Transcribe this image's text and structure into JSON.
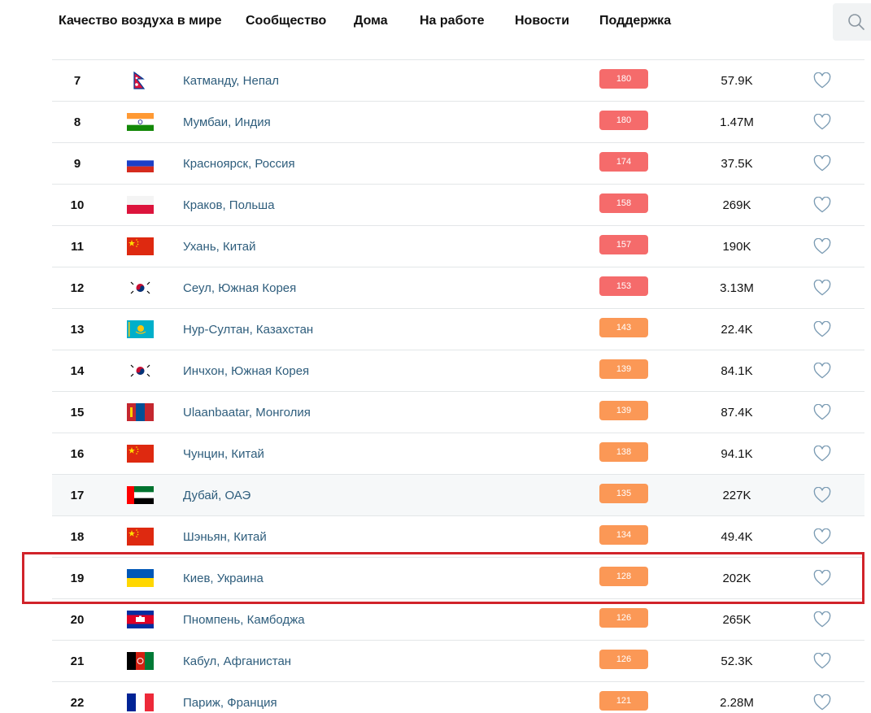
{
  "nav": {
    "items": [
      {
        "label": "Качество воздуха в мире",
        "name": "nav-air-quality-world"
      },
      {
        "label": "Сообщество",
        "name": "nav-community"
      },
      {
        "label": "Дома",
        "name": "nav-home"
      },
      {
        "label": "На работе",
        "name": "nav-work"
      },
      {
        "label": "Новости",
        "name": "nav-news"
      },
      {
        "label": "Поддержка",
        "name": "nav-support"
      }
    ],
    "search_icon": "search-icon"
  },
  "colors": {
    "aqi_red": "#f56b6b",
    "aqi_orange": "#fb9856",
    "highlight": "#d1232a",
    "city_link": "#2e5d7c"
  },
  "rows": [
    {
      "rank": "7",
      "city": "Катманду, Непал",
      "aqi": "180",
      "level": "red",
      "followers": "57.9K",
      "flag": "nepal"
    },
    {
      "rank": "8",
      "city": "Мумбаи, Индия",
      "aqi": "180",
      "level": "red",
      "followers": "1.47M",
      "flag": "india"
    },
    {
      "rank": "9",
      "city": "Красноярск, Россия",
      "aqi": "174",
      "level": "red",
      "followers": "37.5K",
      "flag": "russia"
    },
    {
      "rank": "10",
      "city": "Краков, Польша",
      "aqi": "158",
      "level": "red",
      "followers": "269K",
      "flag": "poland"
    },
    {
      "rank": "11",
      "city": "Ухань, Китай",
      "aqi": "157",
      "level": "red",
      "followers": "190K",
      "flag": "china"
    },
    {
      "rank": "12",
      "city": "Сеул, Южная Корея",
      "aqi": "153",
      "level": "red",
      "followers": "3.13M",
      "flag": "korea"
    },
    {
      "rank": "13",
      "city": "Нур-Султан, Казахстан",
      "aqi": "143",
      "level": "orange",
      "followers": "22.4K",
      "flag": "kazakhstan"
    },
    {
      "rank": "14",
      "city": "Инчхон, Южная Корея",
      "aqi": "139",
      "level": "orange",
      "followers": "84.1K",
      "flag": "korea"
    },
    {
      "rank": "15",
      "city": "Ulaanbaatar, Монголия",
      "aqi": "139",
      "level": "orange",
      "followers": "87.4K",
      "flag": "mongolia"
    },
    {
      "rank": "16",
      "city": "Чунцин, Китай",
      "aqi": "138",
      "level": "orange",
      "followers": "94.1K",
      "flag": "china"
    },
    {
      "rank": "17",
      "city": "Дубай, ОАЭ",
      "aqi": "135",
      "level": "orange",
      "followers": "227K",
      "flag": "uae",
      "hover": true
    },
    {
      "rank": "18",
      "city": "Шэньян, Китай",
      "aqi": "134",
      "level": "orange",
      "followers": "49.4K",
      "flag": "china"
    },
    {
      "rank": "19",
      "city": "Киев, Украина",
      "aqi": "128",
      "level": "orange",
      "followers": "202K",
      "flag": "ukraine",
      "highlighted": true
    },
    {
      "rank": "20",
      "city": "Пномпень, Камбоджа",
      "aqi": "126",
      "level": "orange",
      "followers": "265K",
      "flag": "cambodia"
    },
    {
      "rank": "21",
      "city": "Кабул, Афганистан",
      "aqi": "126",
      "level": "orange",
      "followers": "52.3K",
      "flag": "afghanistan"
    },
    {
      "rank": "22",
      "city": "Париж, Франция",
      "aqi": "121",
      "level": "orange",
      "followers": "2.28M",
      "flag": "france"
    }
  ]
}
